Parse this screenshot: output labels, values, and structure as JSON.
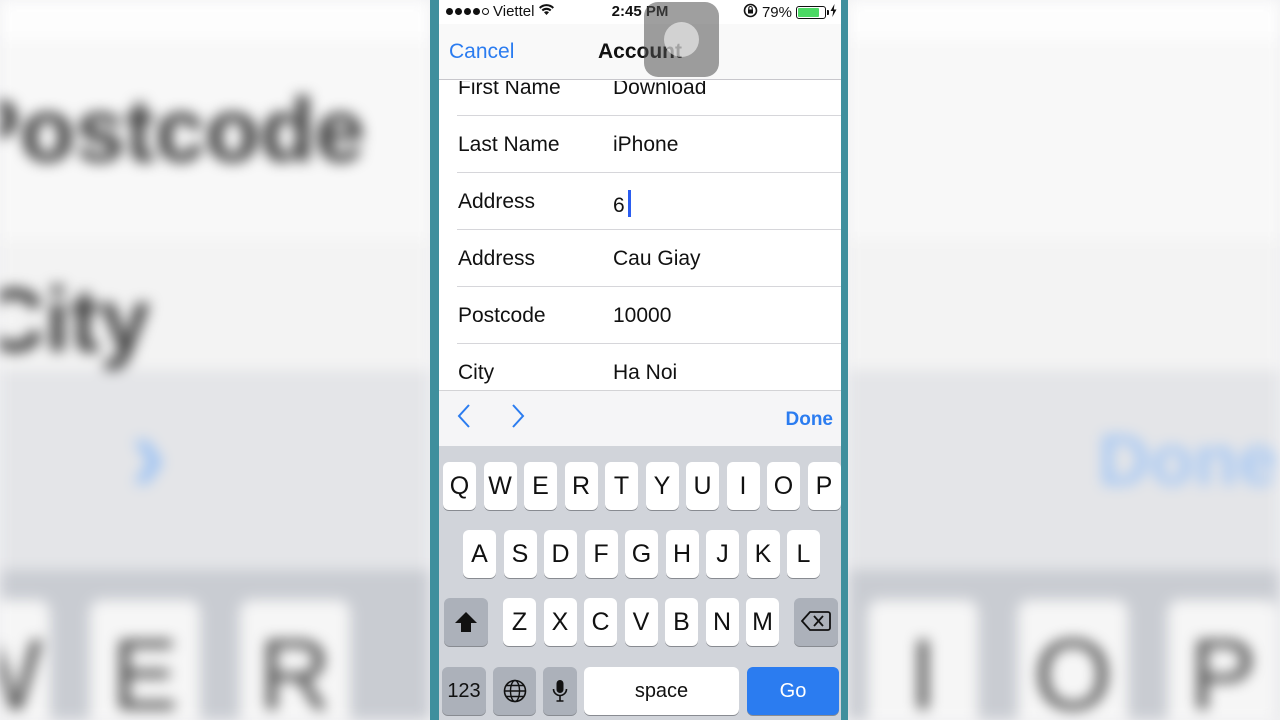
{
  "status_bar": {
    "carrier": "Viettel",
    "time": "2:45 PM",
    "battery": "79%",
    "battery_level": 0.79
  },
  "nav": {
    "cancel": "Cancel",
    "title": "Account"
  },
  "form": {
    "fields": [
      {
        "label": "First Name",
        "value": "Download"
      },
      {
        "label": "Last Name",
        "value": "iPhone"
      },
      {
        "label": "Address",
        "value": "6"
      },
      {
        "label": "Address",
        "value": "Cau Giay"
      },
      {
        "label": "Postcode",
        "value": "10000"
      },
      {
        "label": "City",
        "value": "Ha Noi"
      }
    ]
  },
  "accessory": {
    "prev": "‹",
    "next": "›",
    "done": "Done"
  },
  "keyboard": {
    "row1": [
      "Q",
      "W",
      "E",
      "R",
      "T",
      "Y",
      "U",
      "I",
      "O",
      "P"
    ],
    "row2": [
      "A",
      "S",
      "D",
      "F",
      "G",
      "H",
      "J",
      "K",
      "L"
    ],
    "row3": [
      "Z",
      "X",
      "C",
      "V",
      "B",
      "N",
      "M"
    ],
    "numbers_key": "123",
    "space_key": "space",
    "go_key": "Go"
  },
  "colors": {
    "accent": "#2b7cf0",
    "frame": "#3f8f9d",
    "battery_fill": "#4cd964"
  }
}
